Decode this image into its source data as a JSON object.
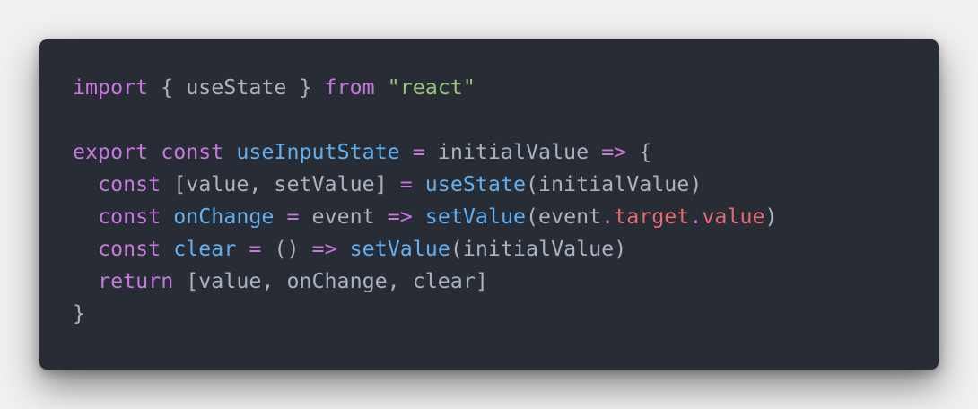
{
  "colors": {
    "background": "#282c34",
    "page": "#f0f0f0",
    "keyword": "#c678dd",
    "function": "#61afef",
    "string": "#98c379",
    "property": "#e06c75",
    "plain": "#abb2bf"
  },
  "code": {
    "lines": [
      [
        {
          "t": "import",
          "k": "kw"
        },
        {
          "t": " { useState } ",
          "k": "plain"
        },
        {
          "t": "from",
          "k": "kw"
        },
        {
          "t": " ",
          "k": "plain"
        },
        {
          "t": "\"react\"",
          "k": "str"
        }
      ],
      [],
      [
        {
          "t": "export",
          "k": "kw"
        },
        {
          "t": " ",
          "k": "plain"
        },
        {
          "t": "const",
          "k": "kw"
        },
        {
          "t": " ",
          "k": "plain"
        },
        {
          "t": "useInputState",
          "k": "fn"
        },
        {
          "t": " ",
          "k": "plain"
        },
        {
          "t": "=",
          "k": "kw"
        },
        {
          "t": " initialValue ",
          "k": "plain"
        },
        {
          "t": "=>",
          "k": "kw"
        },
        {
          "t": " {",
          "k": "plain"
        }
      ],
      [
        {
          "t": "  ",
          "k": "plain"
        },
        {
          "t": "const",
          "k": "kw"
        },
        {
          "t": " [value, setValue] ",
          "k": "plain"
        },
        {
          "t": "=",
          "k": "kw"
        },
        {
          "t": " ",
          "k": "plain"
        },
        {
          "t": "useState",
          "k": "fn"
        },
        {
          "t": "(initialValue)",
          "k": "plain"
        }
      ],
      [
        {
          "t": "  ",
          "k": "plain"
        },
        {
          "t": "const",
          "k": "kw"
        },
        {
          "t": " ",
          "k": "plain"
        },
        {
          "t": "onChange",
          "k": "fn"
        },
        {
          "t": " ",
          "k": "plain"
        },
        {
          "t": "=",
          "k": "kw"
        },
        {
          "t": " event ",
          "k": "plain"
        },
        {
          "t": "=>",
          "k": "kw"
        },
        {
          "t": " ",
          "k": "plain"
        },
        {
          "t": "setValue",
          "k": "fn"
        },
        {
          "t": "(event",
          "k": "plain"
        },
        {
          "t": ".",
          "k": "kw"
        },
        {
          "t": "target",
          "k": "prop"
        },
        {
          "t": ".",
          "k": "kw"
        },
        {
          "t": "value",
          "k": "prop"
        },
        {
          "t": ")",
          "k": "plain"
        }
      ],
      [
        {
          "t": "  ",
          "k": "plain"
        },
        {
          "t": "const",
          "k": "kw"
        },
        {
          "t": " ",
          "k": "plain"
        },
        {
          "t": "clear",
          "k": "fn"
        },
        {
          "t": " ",
          "k": "plain"
        },
        {
          "t": "=",
          "k": "kw"
        },
        {
          "t": " () ",
          "k": "plain"
        },
        {
          "t": "=>",
          "k": "kw"
        },
        {
          "t": " ",
          "k": "plain"
        },
        {
          "t": "setValue",
          "k": "fn"
        },
        {
          "t": "(initialValue)",
          "k": "plain"
        }
      ],
      [
        {
          "t": "  ",
          "k": "plain"
        },
        {
          "t": "return",
          "k": "kw"
        },
        {
          "t": " [value, onChange, clear]",
          "k": "plain"
        }
      ],
      [
        {
          "t": "}",
          "k": "plain"
        }
      ]
    ]
  }
}
